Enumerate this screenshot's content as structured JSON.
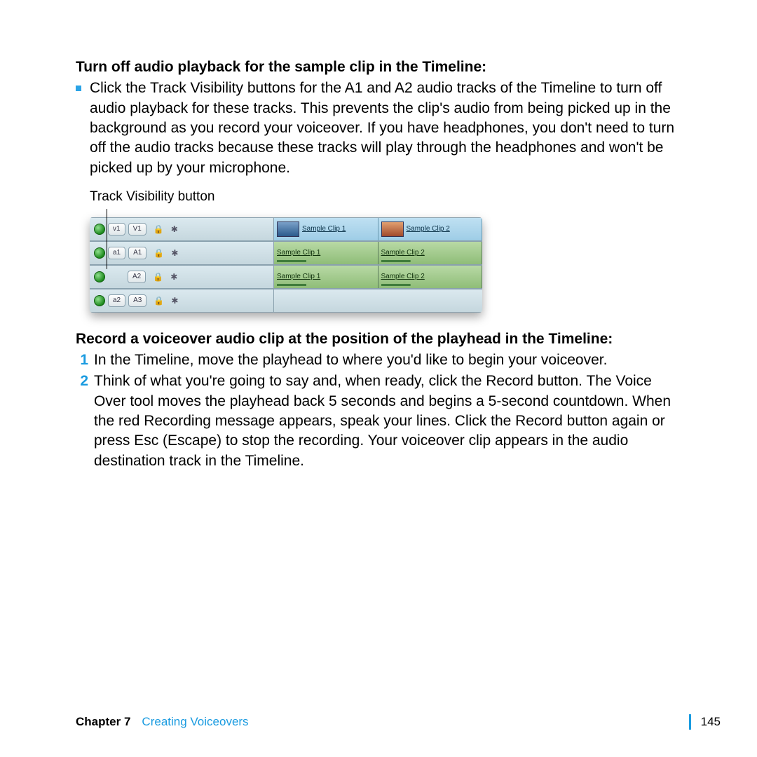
{
  "sections": {
    "turnoff_heading": "Turn off audio playback for the sample clip in the Timeline:",
    "turnoff_body": "Click the Track Visibility buttons for the A1 and A2 audio tracks of the Timeline to turn off audio playback for these tracks. This prevents the clip's audio from being picked up in the background as you record your voiceover. If you have headphones, you don't need to turn off the audio tracks because these tracks will play through the headphones and won't be picked up by your microphone.",
    "callout_label": "Track Visibility button",
    "record_heading": "Record a voiceover audio clip at the position of the playhead in the Timeline:",
    "step1": "In the Timeline, move the playhead to where you'd like to begin your voiceover.",
    "step2": "Think of what you're going to say and, when ready, click the Record button. The Voice Over tool moves the playhead back 5 seconds and begins a 5-second countdown. When the red Recording message appears, speak your lines. Click the Record button again or press Esc (Escape) to stop the recording. Your voiceover clip appears in the audio destination track in the Timeline.",
    "num1": "1",
    "num2": "2"
  },
  "timeline": {
    "tracks": {
      "v1": {
        "src": "v1",
        "dst": "V1"
      },
      "a1": {
        "src": "a1",
        "dst": "A1"
      },
      "a2": {
        "src": "",
        "dst": "A2"
      },
      "a3": {
        "src": "a2",
        "dst": "A3"
      }
    },
    "clips": {
      "c1": "Sample Clip 1",
      "c2": "Sample Clip 2"
    },
    "icons": {
      "lock": "🔒",
      "gear": "✱"
    }
  },
  "footer": {
    "chapter_label": "Chapter 7",
    "chapter_title": "Creating Voiceovers",
    "page": "145"
  }
}
